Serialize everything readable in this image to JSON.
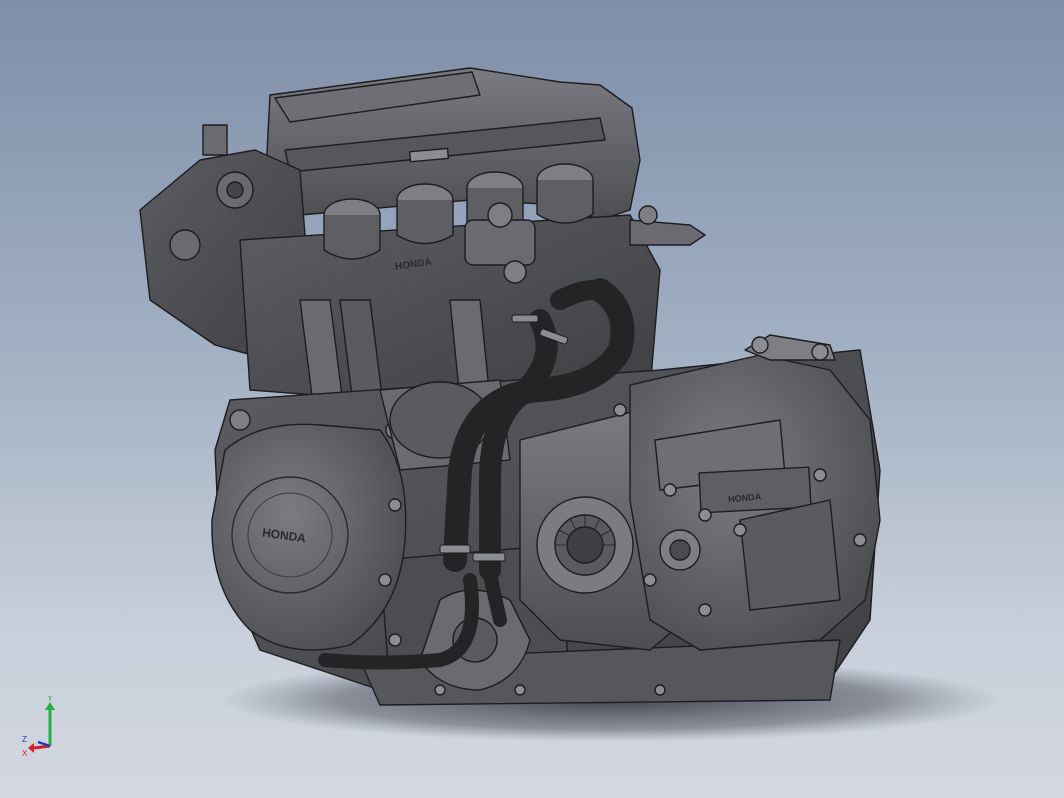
{
  "viewport": {
    "background_top": "#7d8ea8",
    "background_bottom": "#d3d8e0"
  },
  "model": {
    "body_color": "#5f6064",
    "edge_color": "#1d1d20",
    "highlight_color": "#8c8d92",
    "hose_color": "#242426",
    "emboss_left_cover": "HONDA",
    "emboss_head": "HONDA",
    "emboss_right_cover": "HONDA"
  },
  "triad": {
    "y_label": "Y",
    "x_label": "X",
    "z_label": "Z",
    "y_color": "#1fb33a",
    "x_color": "#d62020",
    "z_color": "#2233cc"
  }
}
